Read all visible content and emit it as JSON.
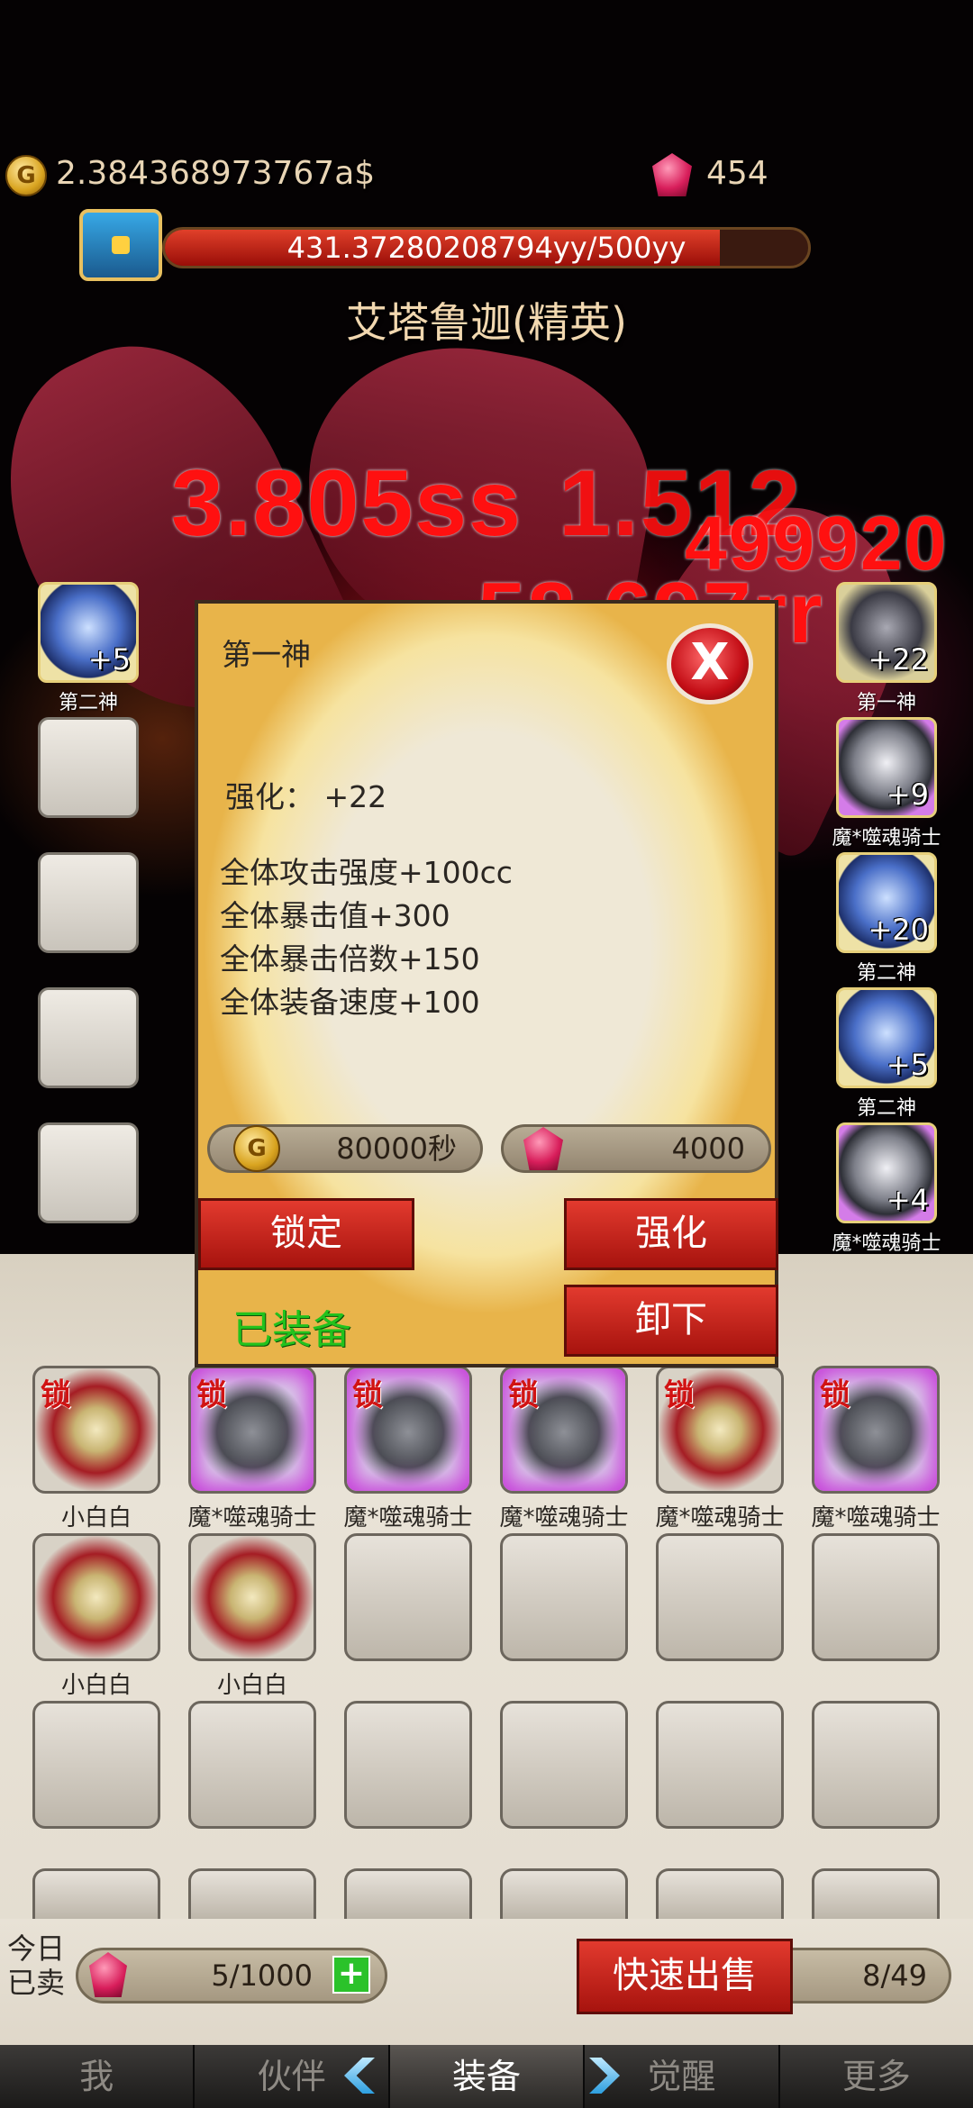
{
  "currency": {
    "gold": "2.384368973767a$",
    "gems": "454"
  },
  "boss": {
    "hp_text": "431.37280208794yy/500yy",
    "hp_fraction": 0.863,
    "name": "艾塔鲁迦(精英)"
  },
  "damage_numbers": [
    "3.805ss",
    "1.512",
    "499920",
    "58.697rr"
  ],
  "side_equipment": {
    "left": [
      {
        "name": "第二神",
        "plus": "+5",
        "icon": "blue-armor-icon"
      }
    ],
    "right": [
      {
        "name": "第一神",
        "plus": "+22",
        "icon": "dark-helmet-icon"
      },
      {
        "name": "魔*噬魂骑士",
        "plus": "+9",
        "icon": "grey-armor-icon"
      },
      {
        "name": "第二神",
        "plus": "+20",
        "icon": "blue-armor-icon"
      },
      {
        "name": "第二神",
        "plus": "+5",
        "icon": "blue-armor-icon"
      },
      {
        "name": "魔*噬魂骑士",
        "plus": "+4",
        "icon": "grey-armor-icon"
      }
    ]
  },
  "modal": {
    "title": "第一神",
    "close_label": "X",
    "enhance_level": "强化：  +22",
    "stats": [
      "全体攻击强度+100cc",
      "全体暴击值+300",
      "全体暴击倍数+150",
      "全体装备速度+100"
    ],
    "gold_cost": "80000秒",
    "gem_cost": "4000",
    "lock_label": "锁定",
    "enhance_label": "强化",
    "equipped_label": "已装备",
    "unequip_label": "卸下"
  },
  "bag": {
    "lock_glyph": "锁",
    "row1": [
      {
        "name": "小白白",
        "icon": "gold-armor-icon"
      },
      {
        "name": "魔*噬魂骑士",
        "icon": "grey-armor-icon"
      },
      {
        "name": "魔*噬魂骑士",
        "icon": "grey-armor-icon"
      },
      {
        "name": "魔*噬魂骑士",
        "icon": "grey-armor-icon"
      },
      {
        "name": "魔*噬魂骑士",
        "icon": "gold-armor-icon"
      },
      {
        "name": "魔*噬魂骑士",
        "icon": "grey-armor-icon"
      }
    ],
    "row2": [
      {
        "name": "小白白",
        "icon": "gold-armor-icon"
      },
      {
        "name": "小白白",
        "icon": "gold-armor-icon"
      }
    ]
  },
  "footer": {
    "sold_label_line1": "今日",
    "sold_label_line2": "已卖",
    "sold_count": "5/1000",
    "add_symbol": "+",
    "quick_sell_label": "快速出售",
    "capacity": "8/49"
  },
  "nav": {
    "items": [
      "我",
      "伙伴",
      "装备",
      "觉醒",
      "更多"
    ],
    "active_index": 2
  },
  "colors": {
    "accent_red": "#c41a12",
    "equipped_green": "#22c21d"
  }
}
